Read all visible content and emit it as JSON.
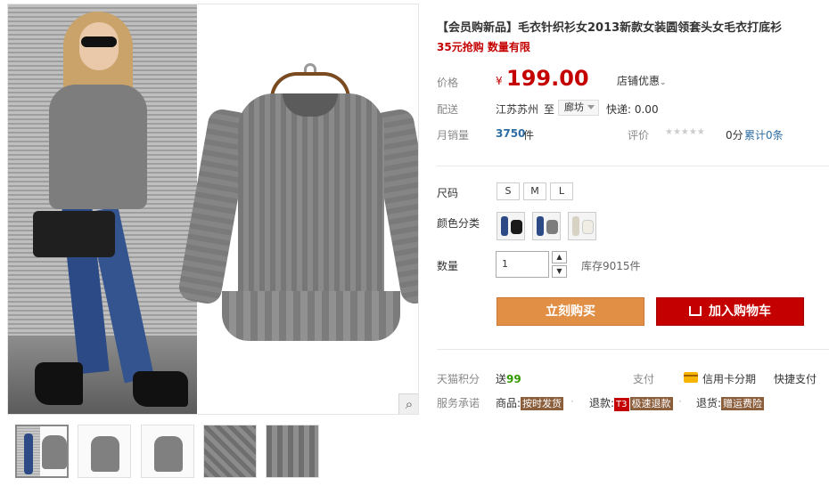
{
  "product": {
    "title": "【会员购新品】毛衣针织衫女2013新款女装圆领套头女毛衣打底衫",
    "promo": "35元抢购 数量有限"
  },
  "price": {
    "label": "价格",
    "currency": "¥",
    "value": "199.00",
    "store_promo": "店铺优惠",
    "store_promo_arrow": "⌄"
  },
  "shipping": {
    "label": "配送",
    "from": "江苏苏州",
    "to": "至",
    "destination": "廊坊",
    "express": "快递: 0.00"
  },
  "sales": {
    "label": "月销量",
    "count": "3750",
    "unit": "件",
    "rating_label": "评价",
    "stars": "★★★★★",
    "score": "0分",
    "reviews": "累计0条"
  },
  "sku": {
    "size_label": "尺码",
    "sizes": [
      "S",
      "M",
      "L"
    ],
    "color_label": "颜色分类",
    "colors": [
      "black",
      "gray",
      "white"
    ],
    "color_hex": [
      "#1a1a1a",
      "#7d7d7d",
      "#f0ede4"
    ]
  },
  "quantity": {
    "label": "数量",
    "value": "1",
    "up": "▲",
    "down": "▼",
    "stock": "库存9015件"
  },
  "buttons": {
    "buy_now": "立刻购买",
    "add_to_cart": "加入购物车"
  },
  "points": {
    "label": "天猫积分",
    "prefix": "送",
    "value": "99"
  },
  "payment": {
    "label": "支付",
    "credit": "信用卡分期",
    "quick": "快捷支付"
  },
  "service": {
    "label": "服务承诺",
    "item1_prefix": "商品:",
    "item1_tag": "按时发货",
    "item2_prefix": "退款:",
    "item2_badge": "T3",
    "item2_tag": "极速退款",
    "item3_prefix": "退货:",
    "item3_tag": "赠运费险",
    "separator": "·"
  },
  "gallery": {
    "zoom": "⌕"
  },
  "colors": {
    "price_red": "#c40000",
    "buy_now_orange": "#e08f45",
    "cart_red": "#c40000",
    "link_blue": "#2d6da3"
  }
}
